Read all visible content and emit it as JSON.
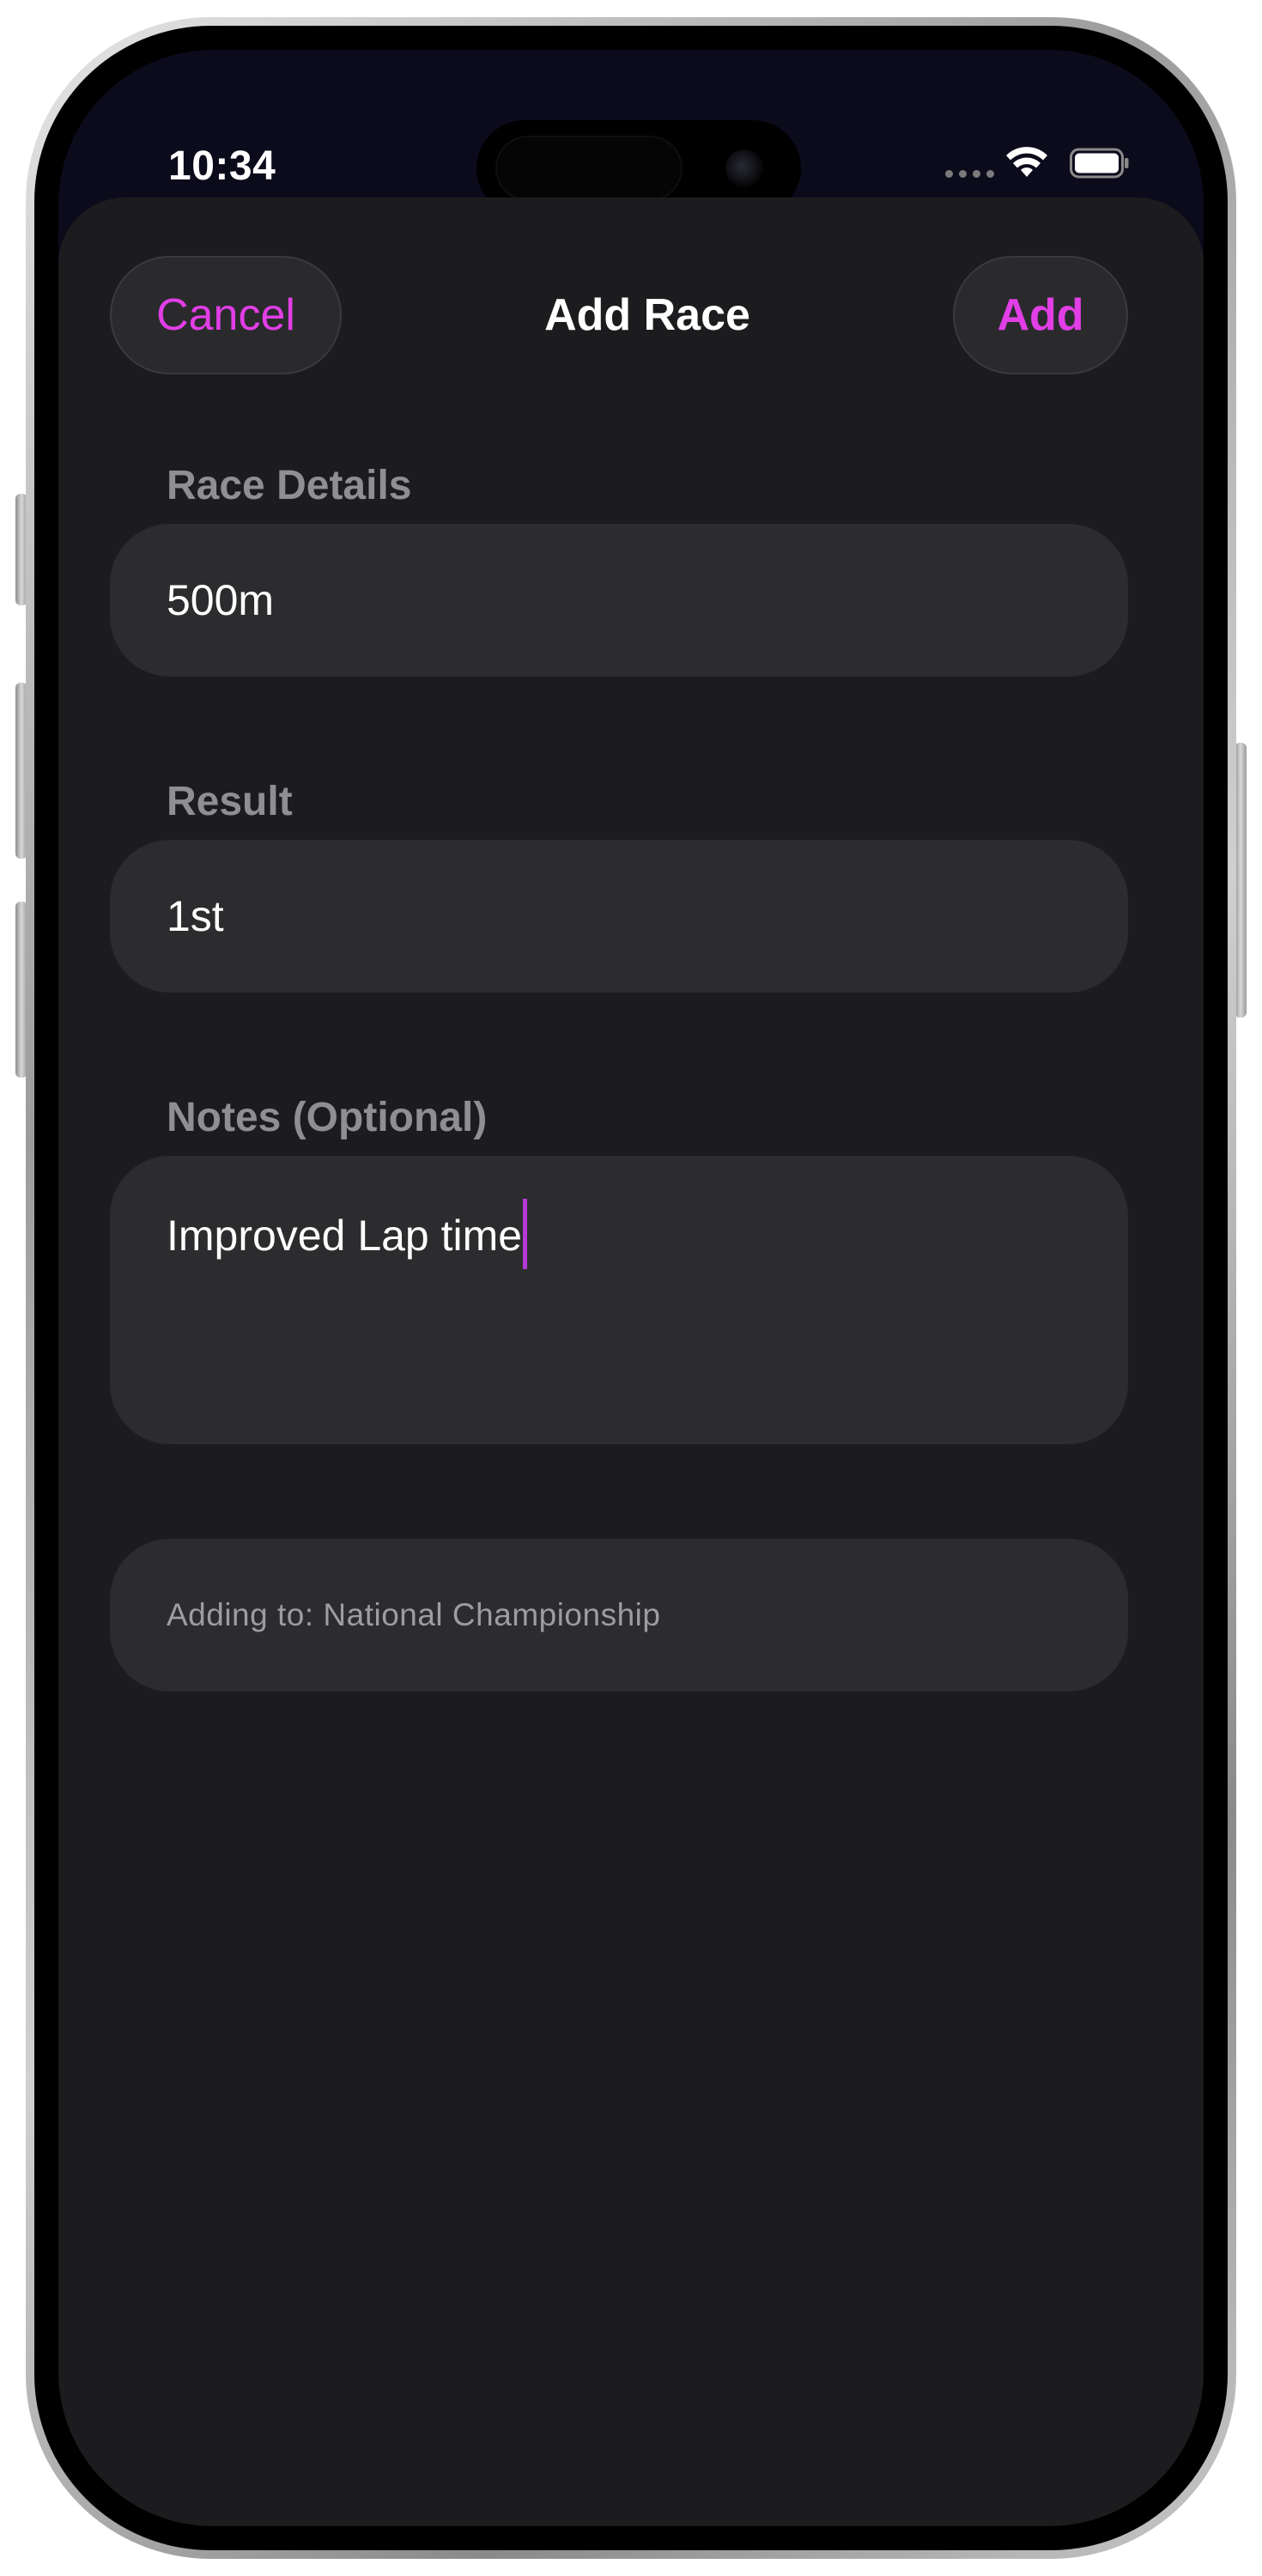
{
  "status_bar": {
    "time": "10:34",
    "signal_icon": "cellular-dots-icon",
    "wifi_icon": "wifi-icon",
    "battery_icon": "battery-icon"
  },
  "nav": {
    "cancel_label": "Cancel",
    "title": "Add Race",
    "add_label": "Add"
  },
  "form": {
    "race_details": {
      "label": "Race Details",
      "value": "500m"
    },
    "result": {
      "label": "Result",
      "value": "1st"
    },
    "notes": {
      "label": "Notes (Optional)",
      "value": "Improved Lap time"
    }
  },
  "info": {
    "text": "Adding to: National Championship"
  },
  "colors": {
    "accent": "#e23ee6",
    "sheet_background": "#1c1c1e",
    "field_background": "#2c2c2e",
    "label": "#8e8e93",
    "caret": "#b43ad4"
  }
}
